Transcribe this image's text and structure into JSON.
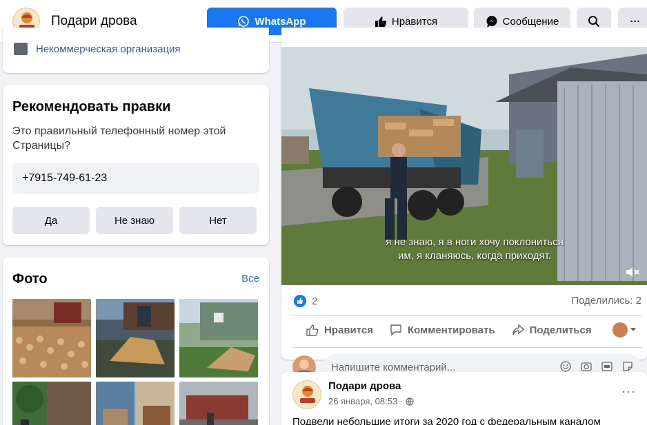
{
  "page": {
    "name": "Подари дрова"
  },
  "header": {
    "whatsapp_label": "WhatsApp",
    "like_label": "Нравится",
    "message_label": "Сообщение",
    "more_label": "···"
  },
  "about": {
    "category": "Некоммерческая организация"
  },
  "suggest_edits": {
    "title": "Рекомендовать правки",
    "question": "Это правильный телефонный номер этой Страницы?",
    "phone": "+7915-749-61-23",
    "answers": {
      "yes": "Да",
      "unknown": "Не знаю",
      "no": "Нет"
    }
  },
  "photos": {
    "title": "Фото",
    "see_all": "Все"
  },
  "post": {
    "subtitle_line1": "я не знаю, я в ноги хочу поклониться",
    "subtitle_line2": "им, я кланяюсь, когда приходят.",
    "like_count": "2",
    "shares": "Поделились: 2",
    "actions": {
      "like": "Нравится",
      "comment": "Комментировать",
      "share": "Поделиться"
    },
    "comment_placeholder": "Напишите комментарий..."
  },
  "post2": {
    "author": "Подари дрова",
    "date": "26 января, 08:53 ·",
    "more": "···",
    "text": "Подвели небольшие итоги за 2020 год с федеральным каналом"
  },
  "colors": {
    "accent": "#1877f2",
    "background": "#f0f2f5",
    "link": "#385898"
  }
}
